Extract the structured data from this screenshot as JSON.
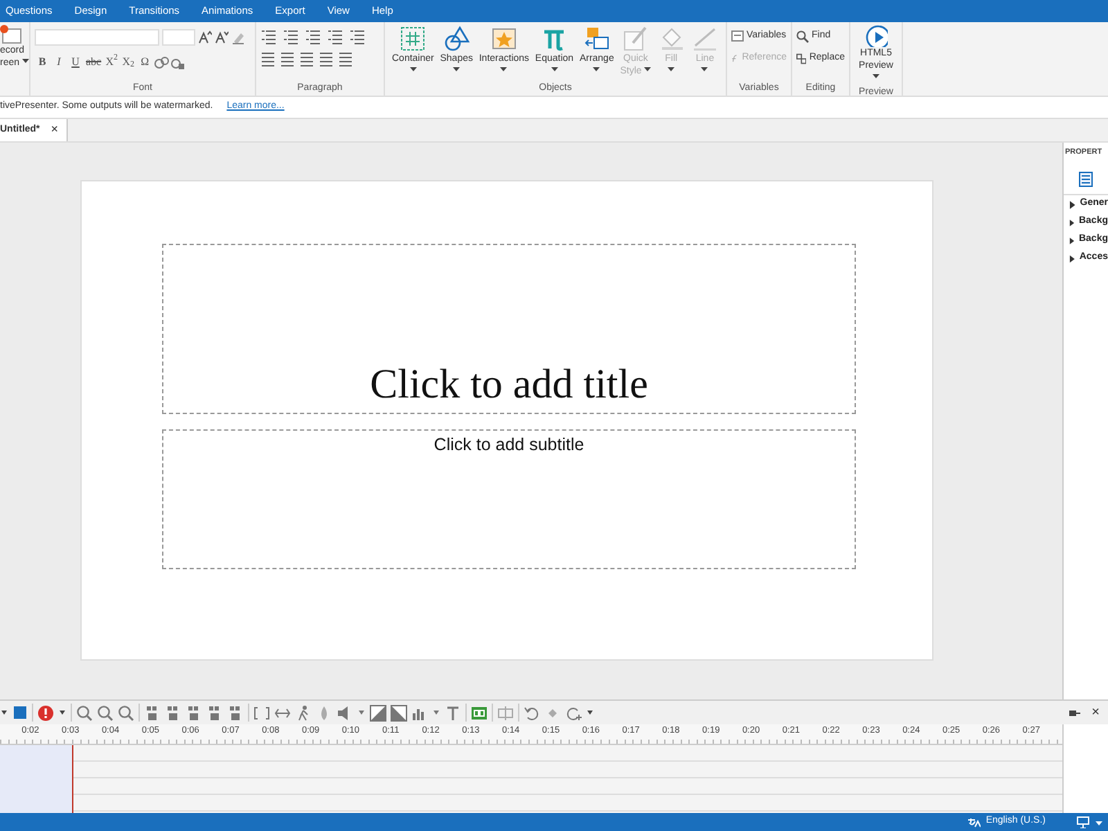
{
  "menu": [
    {
      "label": "Questions"
    },
    {
      "label": "Design"
    },
    {
      "label": "Transitions"
    },
    {
      "label": "Animations"
    },
    {
      "label": "Export"
    },
    {
      "label": "View"
    },
    {
      "label": "Help"
    }
  ],
  "ribbon": {
    "record": {
      "label_lines": [
        "ecord",
        "reen"
      ]
    },
    "font": {
      "label": "Font",
      "format_buttons": [
        "B",
        "I",
        "U",
        "abc",
        "X$^{2}$",
        "X$_{2}$",
        "Ω"
      ]
    },
    "paragraph": {
      "label": "Paragraph"
    },
    "objects": {
      "label": "Objects",
      "buttons": [
        {
          "label": "Container",
          "disabled": false
        },
        {
          "label": "Shapes",
          "disabled": false
        },
        {
          "label": "Interactions",
          "disabled": false
        },
        {
          "label": "Equation",
          "disabled": false
        },
        {
          "label": "Arrange",
          "disabled": false
        },
        {
          "label": "Quick Style",
          "disabled": true
        },
        {
          "label": "Fill",
          "disabled": true
        },
        {
          "label": "Line",
          "disabled": true
        }
      ]
    },
    "variables": {
      "label": "Variables",
      "buttons": [
        {
          "label": "Variables",
          "disabled": false
        },
        {
          "label": "Reference",
          "disabled": true
        }
      ]
    },
    "editing": {
      "label": "Editing",
      "buttons": [
        {
          "label": "Find"
        },
        {
          "label": "Replace"
        }
      ]
    },
    "preview": {
      "label": "Preview",
      "button": {
        "label_lines": [
          "HTML5",
          "Preview"
        ]
      }
    }
  },
  "notice": {
    "text": "tivePresenter. Some outputs will be watermarked.",
    "link": "Learn more..."
  },
  "doc_tabs": [
    {
      "label": "Untitled*",
      "selected": true,
      "close": "×"
    }
  ],
  "slide": {
    "title_placeholder": "Click to add title",
    "subtitle_placeholder": "Click to add subtitle"
  },
  "properties": {
    "title": "PROPERT",
    "sections": [
      {
        "label": "Gener",
        "expanded": false
      },
      {
        "label": "Backg",
        "expanded": false
      },
      {
        "label": "Backg",
        "expanded": false
      },
      {
        "label": "Acces",
        "expanded": false
      }
    ]
  },
  "timeline": {
    "ticks": [
      "0:02",
      "0:03",
      "0:04",
      "0:05",
      "0:06",
      "0:07",
      "0:08",
      "0:09",
      "0:10",
      "0:11",
      "0:12",
      "0:13",
      "0:14",
      "0:15",
      "0:16",
      "0:17",
      "0:18",
      "0:19",
      "0:20",
      "0:21",
      "0:22",
      "0:23",
      "0:24",
      "0:25",
      "0:26",
      "0:27"
    ],
    "close": "×"
  },
  "status_bar": {
    "language": "English (U.S.)"
  }
}
